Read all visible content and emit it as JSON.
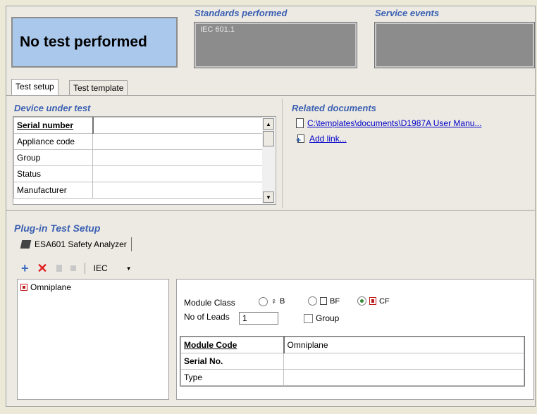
{
  "status": {
    "text": "No test performed"
  },
  "standards": {
    "title": "Standards performed",
    "items": [
      "IEC 601.1"
    ]
  },
  "service_events": {
    "title": "Service events"
  },
  "tabs": [
    {
      "label": "Test setup",
      "active": true
    },
    {
      "label": "Test template",
      "active": false
    }
  ],
  "device": {
    "title": "Device under test",
    "rows": [
      {
        "label": "Serial number",
        "value": ""
      },
      {
        "label": "Appliance code",
        "value": ""
      },
      {
        "label": "Group",
        "value": ""
      },
      {
        "label": "Status",
        "value": ""
      },
      {
        "label": "Manufacturer",
        "value": ""
      }
    ]
  },
  "related": {
    "title": "Related documents",
    "doc_link": "C:\\templates\\documents\\D1987A User Manu...",
    "add_link": "Add link..."
  },
  "plugin": {
    "title": "Plug-in Test Setup",
    "tab_label": "ESA601 Safety Analyzer",
    "standard_dropdown": "IEC",
    "tree_item": "Omniplane",
    "module_class_label": "Module Class",
    "class_options": [
      {
        "label": "B",
        "selected": false
      },
      {
        "label": "BF",
        "selected": false
      },
      {
        "label": "CF",
        "selected": true
      }
    ],
    "leads_label": "No of Leads",
    "leads_value": "1",
    "group_label": "Group",
    "group_checked": false,
    "table": [
      {
        "label": "Module Code",
        "value": "Omniplane"
      },
      {
        "label": "Serial No.",
        "value": ""
      },
      {
        "label": "Type",
        "value": ""
      }
    ]
  },
  "colors": {
    "status_bg": "#aac8ec",
    "section_title": "#3b5fb3",
    "grey_box": "#8c8c8c",
    "link": "#0000c8"
  }
}
